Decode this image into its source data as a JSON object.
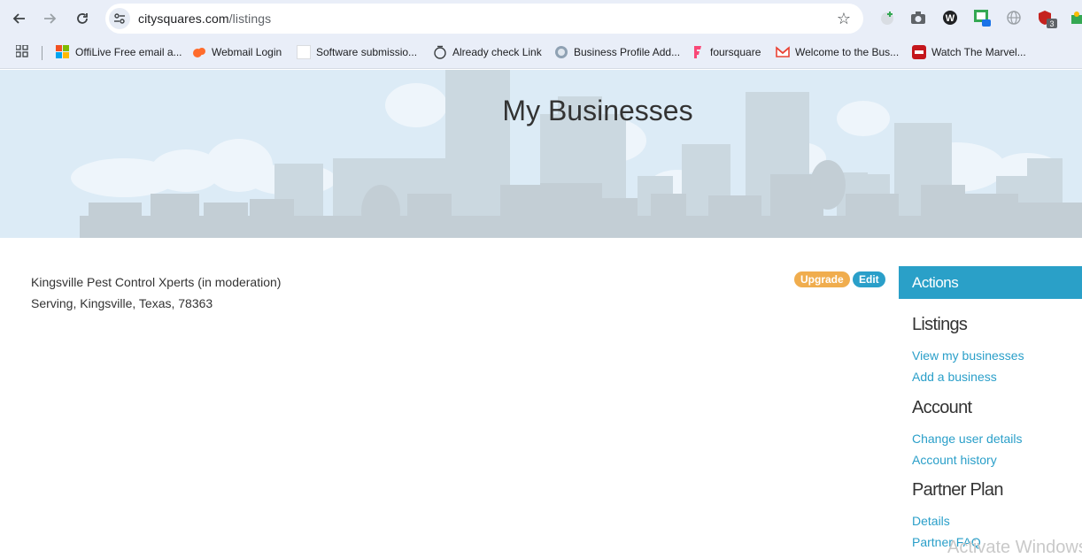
{
  "browser": {
    "url_host": "citysquares.com",
    "url_path": "/listings",
    "extension_badge_count": "3",
    "bookmarks": [
      {
        "label": "OffiLive Free email a...",
        "color": "#f25022"
      },
      {
        "label": "Webmail Login",
        "color": "#ff6c2c"
      },
      {
        "label": "Software submissio...",
        "color": "#ffffff"
      },
      {
        "label": "Already check Link",
        "color": "#3c4043"
      },
      {
        "label": "Business Profile Add...",
        "color": "#5f6368"
      },
      {
        "label": "foursquare",
        "color": "#f94877"
      },
      {
        "label": "Welcome to the Bus...",
        "color": "#ea4335"
      },
      {
        "label": "Watch The Marvel...",
        "color": "#c4161c"
      }
    ]
  },
  "page": {
    "title": "My Businesses",
    "business": {
      "name": "Kingsville Pest Control Xperts (in moderation)",
      "address": "Serving, Kingsville, Texas, 78363",
      "upgrade_label": "Upgrade",
      "edit_label": "Edit"
    },
    "sidebar": {
      "header": "Actions",
      "sections": [
        {
          "title": "Listings",
          "links": [
            "View my businesses",
            "Add a business"
          ]
        },
        {
          "title": "Account",
          "links": [
            "Change user details",
            "Account history"
          ]
        },
        {
          "title": "Partner Plan",
          "links": [
            "Details",
            "Partner FAQ"
          ]
        }
      ]
    }
  },
  "overlay": {
    "watermark": "Activate Windows"
  },
  "colors": {
    "accent": "#2aa0c8",
    "upgrade": "#f0ad4e",
    "hero_bg": "#dcebf6"
  }
}
